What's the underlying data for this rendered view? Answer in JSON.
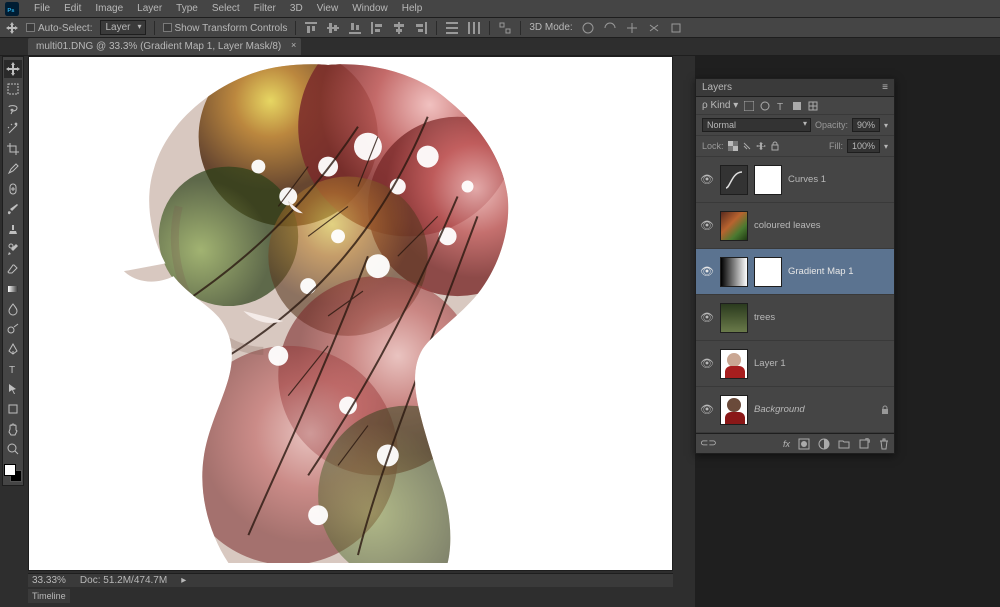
{
  "menu": [
    "File",
    "Edit",
    "Image",
    "Layer",
    "Type",
    "Select",
    "Filter",
    "3D",
    "View",
    "Window",
    "Help"
  ],
  "options": {
    "auto_select_label": "Auto-Select:",
    "auto_select_value": "Layer",
    "show_transform": "Show Transform Controls",
    "mode_label": "3D Mode:"
  },
  "tab": {
    "title": "multi01.DNG @ 33.3% (Gradient Map 1, Layer Mask/8)",
    "close": "×"
  },
  "status": {
    "zoom": "33.33%",
    "doc": "Doc: 51.2M/474.7M"
  },
  "timeline": "Timeline",
  "panel": {
    "title": "Layers",
    "kind_label": "Kind",
    "blend_mode": "Normal",
    "opacity_label": "Opacity:",
    "opacity_value": "90%",
    "lock_label": "Lock:",
    "fill_label": "Fill:",
    "fill_value": "100%",
    "layers": [
      {
        "name": "Curves 1",
        "type": "adjustment",
        "selected": false
      },
      {
        "name": "coloured leaves",
        "type": "image",
        "selected": false
      },
      {
        "name": "Gradient Map 1",
        "type": "adjustment",
        "selected": true
      },
      {
        "name": "trees",
        "type": "image",
        "selected": false
      },
      {
        "name": "Layer 1",
        "type": "image",
        "selected": false
      },
      {
        "name": "Background",
        "type": "bg",
        "selected": false
      }
    ]
  }
}
